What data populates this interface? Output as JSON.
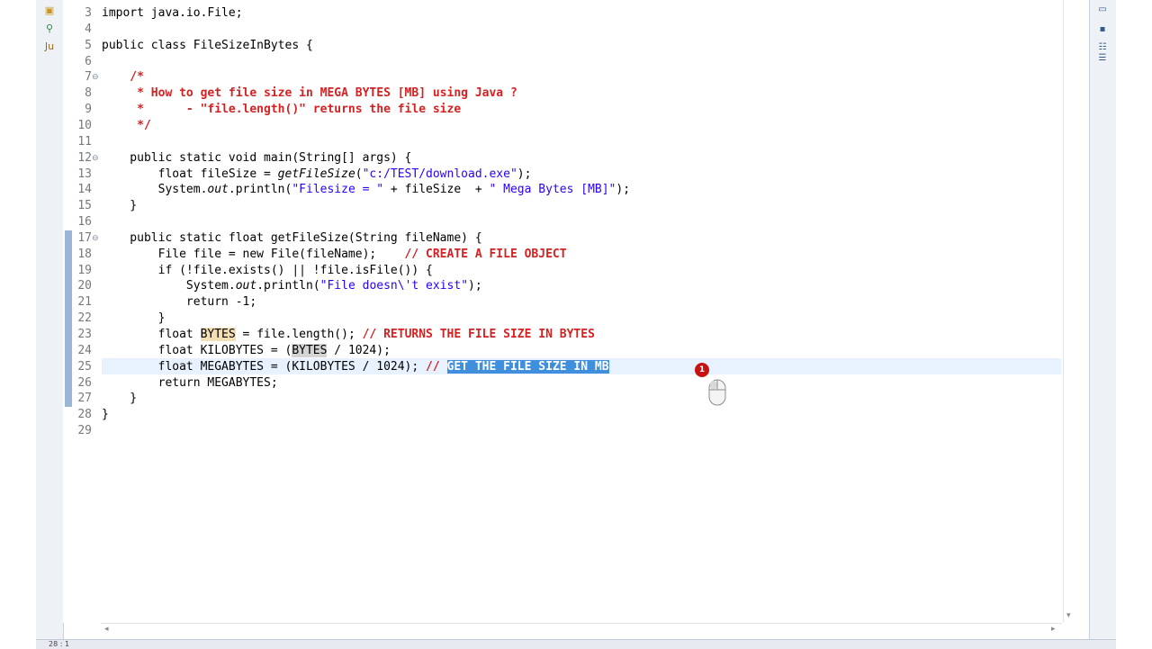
{
  "left_toolbar": [
    {
      "icon": "package-icon",
      "glyph": "▣",
      "color": "#c8961e"
    },
    {
      "icon": "hierarchy-icon",
      "glyph": "⚲",
      "color": "#2e8b3a"
    },
    {
      "icon": "junit-icon",
      "glyph": "Ju",
      "color": "#9a6a1a"
    }
  ],
  "right_toolbar": [
    {
      "icon": "restore-icon",
      "glyph": "▭"
    },
    {
      "icon": "minimize-icon",
      "glyph": "▪"
    },
    {
      "icon": "outline-icon",
      "glyph": "☷"
    },
    {
      "icon": "task-list-icon",
      "glyph": "☰"
    }
  ],
  "editor": {
    "current_line": "25",
    "lines": [
      {
        "n": "3",
        "code": "import java.io.File;"
      },
      {
        "n": "4",
        "code": ""
      },
      {
        "n": "5",
        "code": "public class FileSizeInBytes {"
      },
      {
        "n": "6",
        "code": ""
      },
      {
        "n": "7",
        "code": "    /*",
        "fold": "⊖"
      },
      {
        "n": "8",
        "code": "     * How to get file size in MEGA BYTES [MB] using Java ?"
      },
      {
        "n": "9",
        "code": "     *      - \"file.length()\" returns the file size"
      },
      {
        "n": "10",
        "code": "     */"
      },
      {
        "n": "11",
        "code": ""
      },
      {
        "n": "12",
        "code": "    public static void main(String[] args) {",
        "fold": "⊖"
      },
      {
        "n": "13",
        "code": "        float fileSize = getFileSize(\"c:/TEST/download.exe\");"
      },
      {
        "n": "14",
        "code": "        System.out.println(\"Filesize = \" + fileSize  + \" Mega Bytes [MB]\");"
      },
      {
        "n": "15",
        "code": "    }"
      },
      {
        "n": "16",
        "code": ""
      },
      {
        "n": "17",
        "code": "    public static float getFileSize(String fileName) {",
        "fold": "⊖"
      },
      {
        "n": "18",
        "code": "        File file = new File(fileName);    // CREATE A FILE OBJECT"
      },
      {
        "n": "19",
        "code": "        if (!file.exists() || !file.isFile()) {"
      },
      {
        "n": "20",
        "code": "            System.out.println(\"File doesn\\'t exist\");"
      },
      {
        "n": "21",
        "code": "            return -1;"
      },
      {
        "n": "22",
        "code": "        }"
      },
      {
        "n": "23",
        "code": "        float BYTES = file.length(); // RETURNS THE FILE SIZE IN BYTES"
      },
      {
        "n": "24",
        "code": "        float KILOBYTES = (BYTES / 1024);"
      },
      {
        "n": "25",
        "code": "        float MEGABYTES = (KILOBYTES / 1024); // GET THE FILE SIZE IN MB"
      },
      {
        "n": "26",
        "code": "        return MEGABYTES;"
      },
      {
        "n": "27",
        "code": "    }"
      },
      {
        "n": "28",
        "code": "}"
      },
      {
        "n": "29",
        "code": ""
      }
    ]
  },
  "status_bar": {
    "position": "28 : 1"
  },
  "cursor_overlay": {
    "click_label": "1"
  },
  "colors": {
    "comment": "#d42121",
    "string": "#2a00ff",
    "selection": "#3f8fdd",
    "current_line": "#e8f2fe",
    "occurrence": "#f4dfb4",
    "change_marker": "#9ab6d6"
  }
}
